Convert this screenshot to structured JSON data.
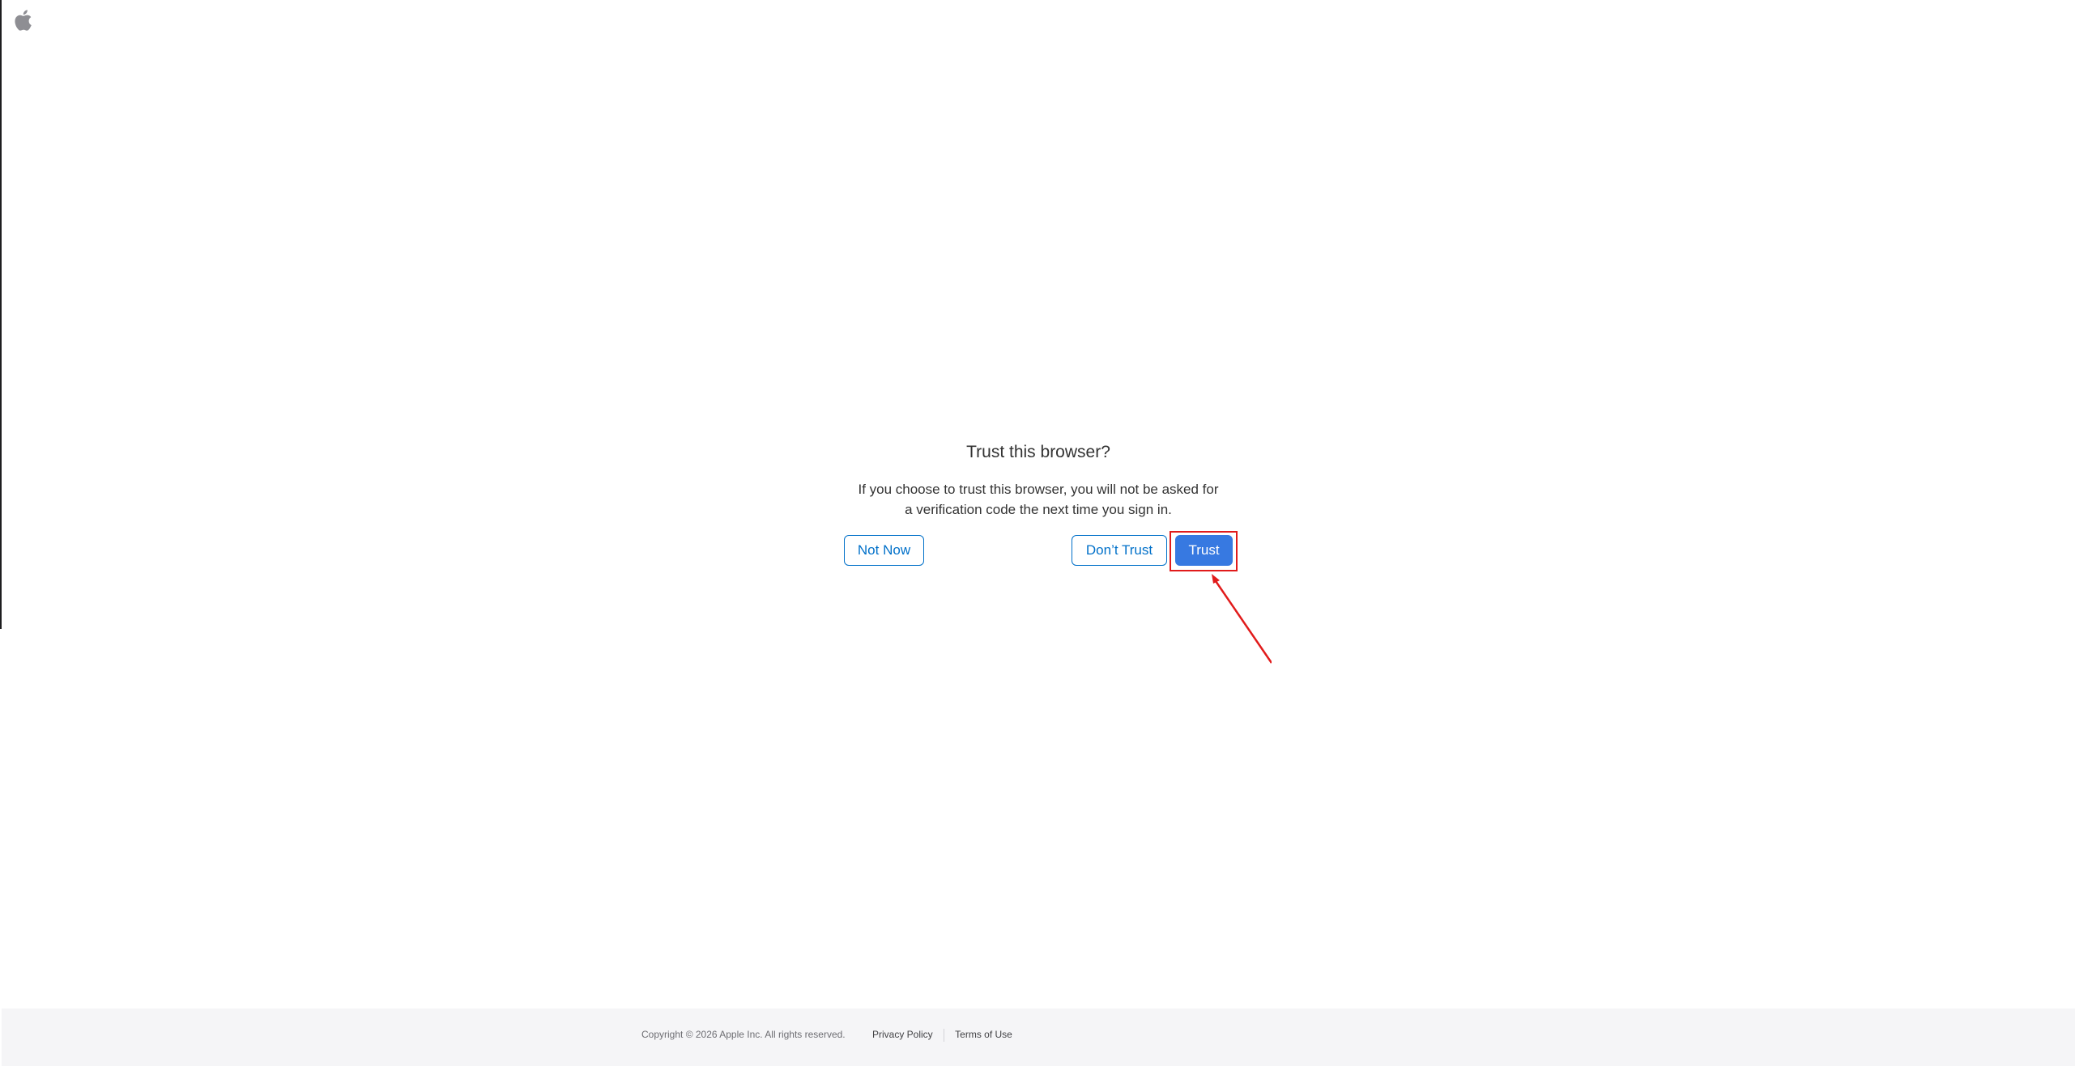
{
  "header": {
    "logo_icon": "apple-logo-icon"
  },
  "dialog": {
    "title": "Trust this browser?",
    "message_line1": "If you choose to trust this browser, you will not be asked for",
    "message_line2": "a verification code the next time you sign in.",
    "buttons": {
      "not_now": "Not Now",
      "dont_trust": "Don’t Trust",
      "trust": "Trust"
    }
  },
  "annotation": {
    "color": "#e11b1b",
    "target": "trust-button"
  },
  "footer": {
    "copyright": "Copyright © 2026 Apple Inc. All rights reserved.",
    "privacy_policy": "Privacy Policy",
    "terms_of_use": "Terms of Use"
  },
  "colors": {
    "primary_button": "#3779e1",
    "link_blue": "#0070c9",
    "footer_bg": "#f5f5f7"
  }
}
